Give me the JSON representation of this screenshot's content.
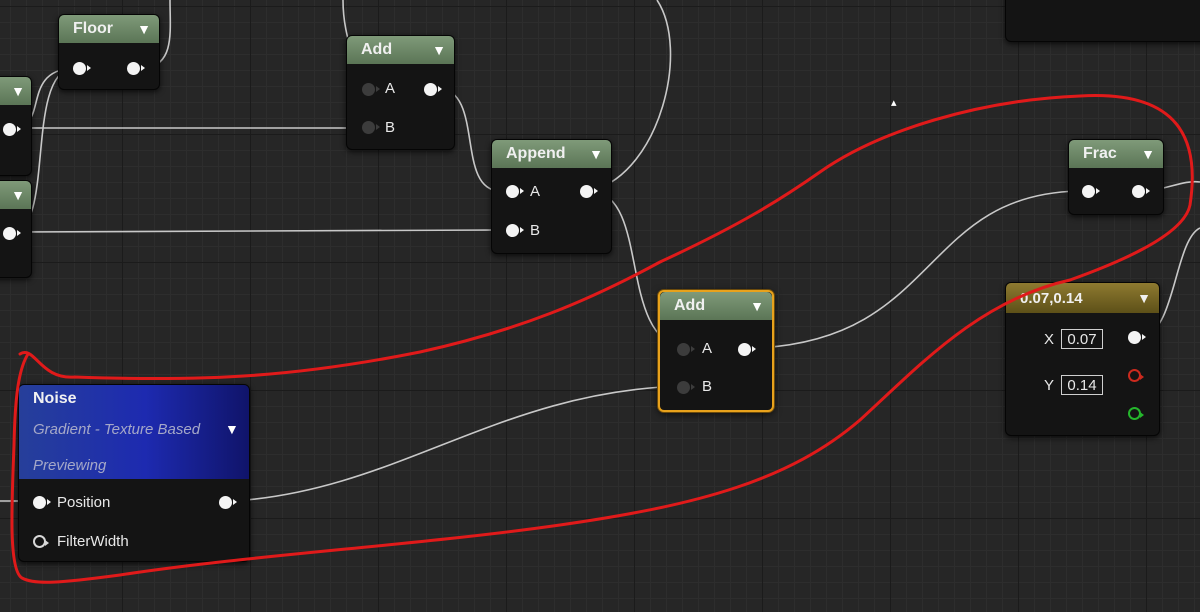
{
  "nodes": {
    "floor": {
      "title": "Floor"
    },
    "add_top": {
      "title": "Add",
      "pin_a": "A",
      "pin_b": "B"
    },
    "append": {
      "title": "Append",
      "pin_a": "A",
      "pin_b": "B"
    },
    "frac": {
      "title": "Frac"
    },
    "add_selected": {
      "title": "Add",
      "pin_a": "A",
      "pin_b": "B"
    },
    "constant2": {
      "title": "0.07,0.14",
      "x_label": "X",
      "x_value": "0.07",
      "y_label": "Y",
      "y_value": "0.14"
    },
    "noise": {
      "title": "Noise",
      "function": "Gradient - Texture Based",
      "status": "Previewing",
      "pin_position": "Position",
      "pin_filterwidth": "FilterWidth"
    }
  },
  "icons": {
    "dropdown": "chevron-down-icon",
    "pin": "pin-icon",
    "cursor": "mouse-cursor-icon"
  },
  "colors": {
    "selection_outline": "#e8a21c",
    "annotation_stroke": "#e01a1a",
    "math_node_header": "#6b8765",
    "noise_header": "#1f2fb0",
    "constant_header": "#7a6a26"
  }
}
